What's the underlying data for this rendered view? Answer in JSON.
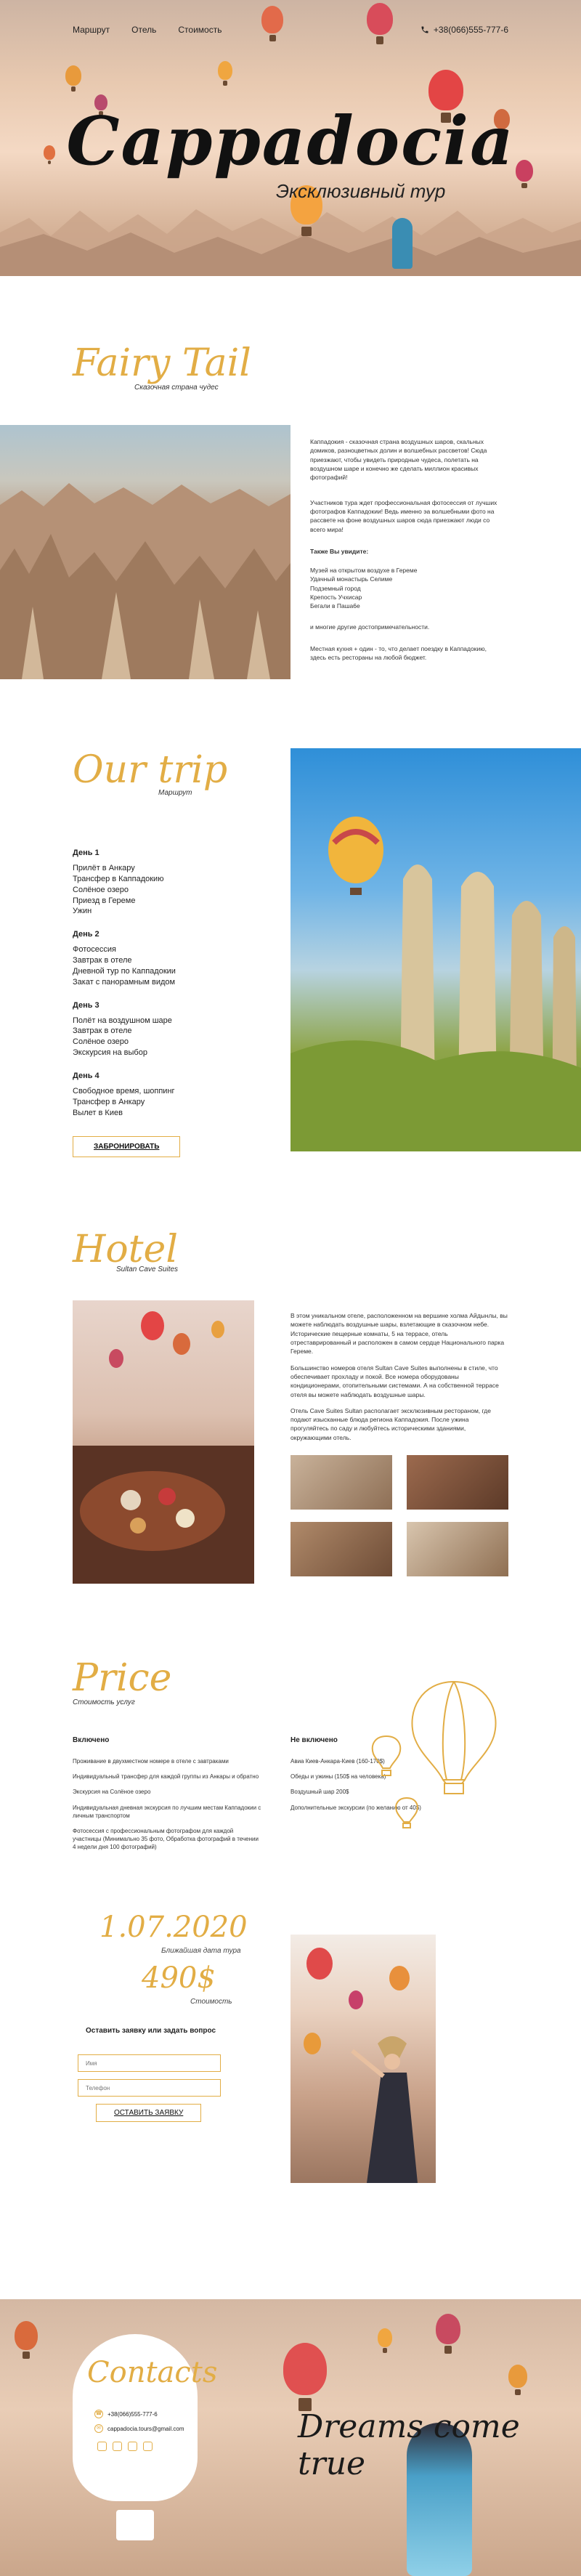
{
  "nav": {
    "items": [
      "Маршрут",
      "Отель",
      "Стоимость"
    ],
    "phone": "+38(066)555-777-6"
  },
  "hero": {
    "title": "Cappadocia",
    "subtitle": "Эксклюзивный тур"
  },
  "fairy": {
    "title": "Fairy Tail",
    "tagline": "Сказочная страна чудес",
    "p1": "Каппадокия - сказочная страна воздушных шаров, скальных домиков, разноцветных долин и волшебных рассветов! Сюда приезжают, чтобы увидеть природные чудеса, полетать на воздушном шаре и конечно же сделать миллион красивых фотографий!",
    "p2": "Участников тура ждет профессиональная фотосессия от лучших фотографов Каппадокии! Ведь именно эа волшебными фото на рассвете на фоне воздушных шаров сюда приезжают люди со всего мира!",
    "see_title": "Также Вы увидите:",
    "see_items": [
      "Музей на открытом воздухе в Гереме",
      "Удачный монастырь Селиме",
      "Подземный город",
      "Крепость Учхисар",
      "Бегали в Паша6е"
    ],
    "p3": "и многие другие достопримечательности.",
    "p4": "Местная кухня + один - то, что делает поездку в Каппадокию, здесь есть рестораны на любой бюджет."
  },
  "trip": {
    "title": "Our trip",
    "tagline": "Маршрут",
    "days": [
      {
        "label": "День 1",
        "items": [
          "Прилёт в Анкару",
          "Трансфер в Каппадокию",
          "Солёное озеро",
          "Приезд в Гереме",
          "Ужин"
        ]
      },
      {
        "label": "День 2",
        "items": [
          "Фотосессия",
          "Завтрак в отеле",
          "Дневной тур по Каппадокии",
          "Закат с панорамным видом"
        ]
      },
      {
        "label": "День 3",
        "items": [
          "Полёт на воздушном шаре",
          "Завтрак в отеле",
          "Солёное озеро",
          "Экскурсия на выбор"
        ]
      },
      {
        "label": "День 4",
        "items": [
          "Свободное время, шоппинг",
          "Трансфер в Анкару",
          "Вылет в Киев"
        ]
      }
    ],
    "button": "ЗАБРОНИРОВАТЬ"
  },
  "hotel": {
    "title": "Hotel",
    "tagline": "Sultan Cave Suites",
    "p1": "В этом уникальном отеле, расположенном на вершине холма Айдынлы, вы можете наблюдать воздушные шары, взлетающие в сказочном небе. Исторические пещерные комнаты, 5 на террасе, отель отреставрированный и расположен в самом сердце Национального парка Гереме.",
    "p2": "Большинство номеров отеля Sultan Cave Suites выполнены в стиле, что обеспечивает прохладу и покой. Все номера оборудованы кондиционерами, отопительными системами. А на собственной террасе отеля вы можете наблюдать воздушные шары.",
    "p3": "Отель Cave Suites Sultan располагает эксклюзивным рестораном, где подают изысканные блюда региона Каппадокия. После ужина прогуляйтесь по саду и любуйтесь историческими зданиями, окружающими отель."
  },
  "price": {
    "title": "Price",
    "tagline": "Стоимость услуг",
    "included_title": "Включено",
    "included": [
      "Проживание в двухместном номере в отеле с завтраками",
      "Индивидуальный трансфер для каждой группы из Анкары и обратно",
      "Экскурсия на Солёное озеро",
      "Индивидуальная дневная экскурсия по лучшим местам Каппадокии с личным транспортом",
      "Фотосессия с профессиональным фотографом для каждой участницы (Минимально 35 фото, Обработка фотографий в течении 4 недели дня 100 фотографий)"
    ],
    "excluded_title": "Не включено",
    "excluded": [
      "Авиа Киев-Анкара-Киев (160-170$)",
      "Обеды и ужины (150$ на человека)",
      "Воздушный шар 200$",
      "Дополнительные экскурсии (по желанию от 40$)"
    ]
  },
  "booking": {
    "date": "1.07.2020",
    "date_caption": "Ближайшая дата тура",
    "price": "490$",
    "price_caption": "Стоимость",
    "form_title": "Оставить заявку или задать вопрос",
    "name_placeholder": "Имя",
    "phone_placeholder": "Телефон",
    "submit": "ОСТАВИТЬ ЗАЯВКУ"
  },
  "contacts": {
    "title": "Contacts",
    "phone": "+38(066)555-777-6",
    "email": "cappadocia.tours@gmail.com",
    "slogan": "Dreams come true"
  },
  "colors": {
    "accent": "#e2ad45",
    "text": "#222222"
  }
}
